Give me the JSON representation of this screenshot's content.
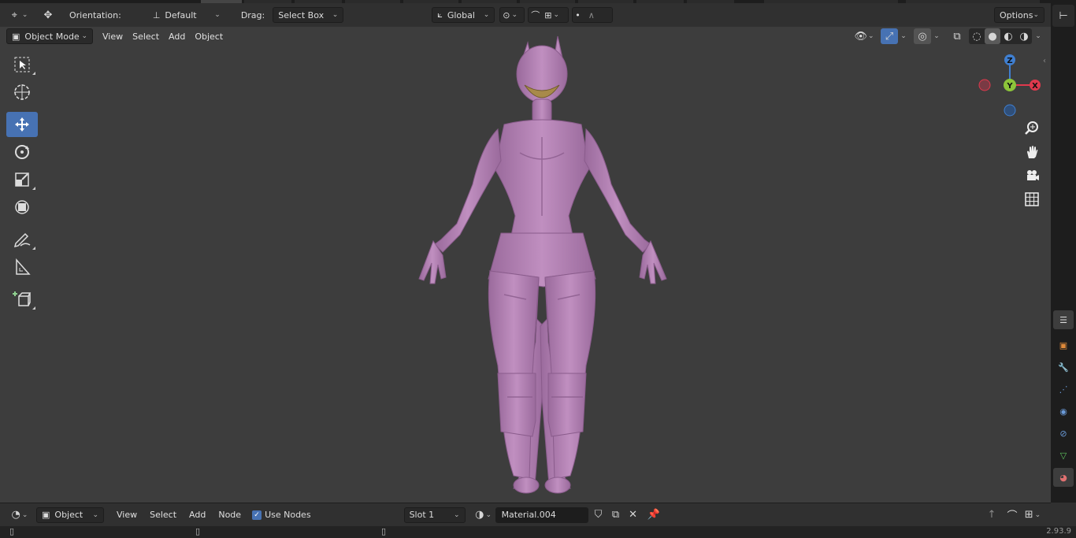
{
  "top_header": {
    "orientation_label": "Orientation:",
    "orientation_value": "Default",
    "drag_label": "Drag:",
    "drag_value": "Select Box",
    "transform_orientation": "Global",
    "options_label": "Options"
  },
  "viewport_header": {
    "mode": "Object Mode",
    "menu": [
      "View",
      "Select",
      "Add",
      "Object"
    ]
  },
  "gizmo": {
    "z": "Z",
    "y": "Y",
    "x": "X"
  },
  "shader_header": {
    "editor_type": "Object",
    "menu": [
      "View",
      "Select",
      "Add",
      "Node"
    ],
    "use_nodes_label": "Use Nodes",
    "use_nodes_checked": true,
    "slot": "Slot 1",
    "material": "Material.004"
  },
  "status": {
    "version": "2.93.9"
  },
  "colors": {
    "accent": "#4772b3",
    "model": "#b07fb0",
    "axis_x": "#e0394d",
    "axis_y": "#8cc43a",
    "axis_z": "#3f7fd1"
  }
}
